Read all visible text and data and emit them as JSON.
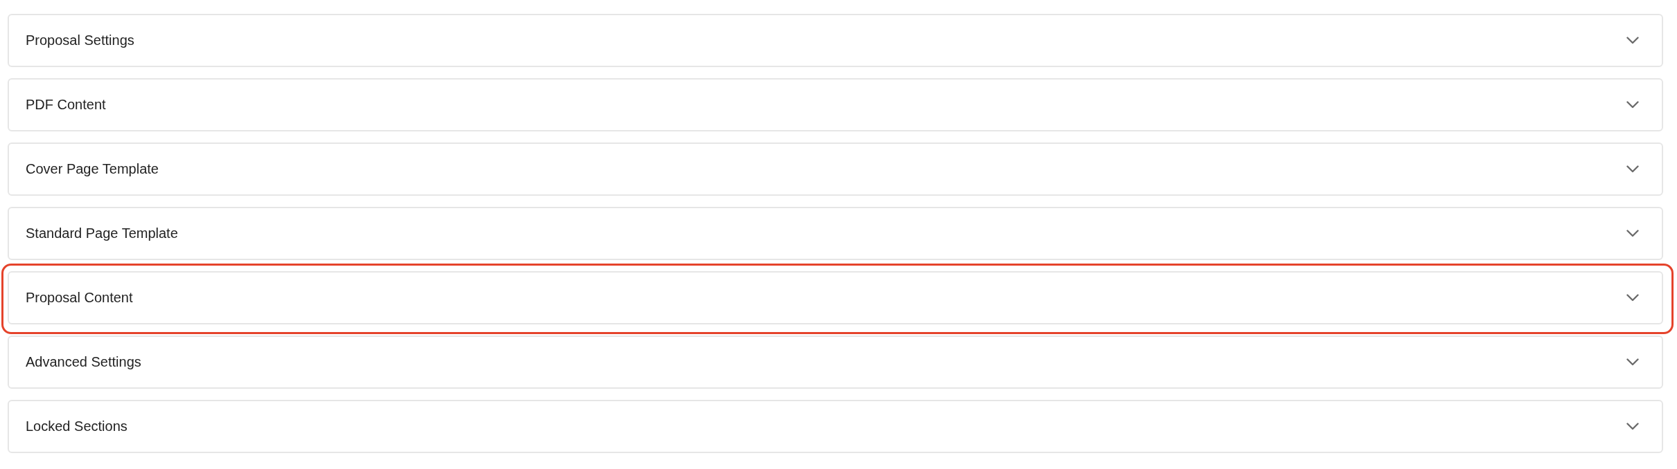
{
  "sections": [
    {
      "title": "Proposal Settings",
      "expanded": false,
      "highlighted": false
    },
    {
      "title": "PDF Content",
      "expanded": false,
      "highlighted": false
    },
    {
      "title": "Cover Page Template",
      "expanded": false,
      "highlighted": false
    },
    {
      "title": "Standard Page Template",
      "expanded": false,
      "highlighted": false
    },
    {
      "title": "Proposal Content",
      "expanded": false,
      "highlighted": true
    },
    {
      "title": "Advanced Settings",
      "expanded": false,
      "highlighted": false
    },
    {
      "title": "Locked Sections",
      "expanded": false,
      "highlighted": false
    }
  ]
}
